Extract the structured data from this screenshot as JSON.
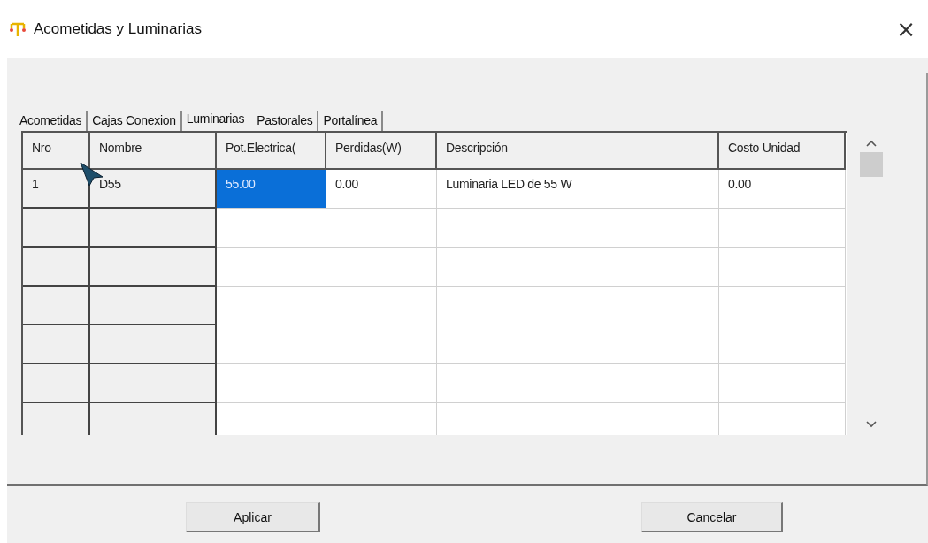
{
  "window": {
    "title": "Acometidas y Luminarias",
    "close": "×"
  },
  "tabs": [
    {
      "label": "Acometidas",
      "selected": false
    },
    {
      "label": "Cajas Conexion",
      "selected": false
    },
    {
      "label": "Luminarias",
      "selected": true
    },
    {
      "label": "Pastorales",
      "selected": false
    },
    {
      "label": "Portalínea",
      "selected": false
    }
  ],
  "table": {
    "columns": [
      {
        "label": "Nro",
        "kind": "fixed"
      },
      {
        "label": "Nombre",
        "kind": "fixed"
      },
      {
        "label": "Pot.Electrica(",
        "kind": "data"
      },
      {
        "label": "Perdidas(W)",
        "kind": "data"
      },
      {
        "label": "Descripción",
        "kind": "data"
      },
      {
        "label": "Costo Unidad",
        "kind": "data"
      }
    ],
    "rows": [
      {
        "cells": [
          {
            "text": "1",
            "selected": false
          },
          {
            "text": "D55",
            "selected": false
          },
          {
            "text": "55.00",
            "selected": true
          },
          {
            "text": "0.00",
            "selected": false
          },
          {
            "text": "Luminaria LED de 55 W",
            "selected": false
          },
          {
            "text": "0.00",
            "selected": false
          }
        ]
      }
    ]
  },
  "buttons": [
    "Aplicar",
    "Cancelar"
  ]
}
